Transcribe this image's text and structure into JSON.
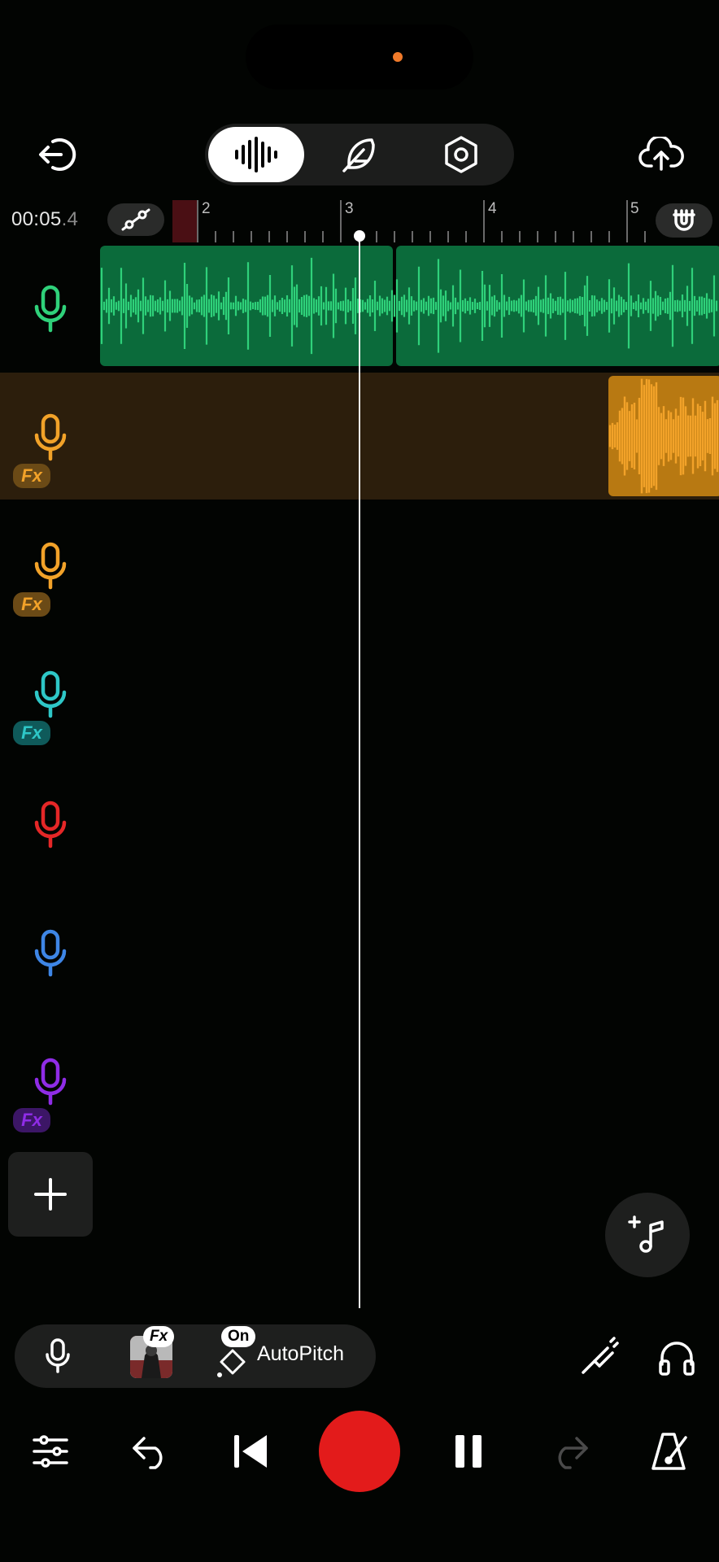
{
  "header": {
    "exit_icon": "exit-icon",
    "upload_icon": "cloud-upload-icon",
    "modes": [
      {
        "id": "waveform",
        "icon": "waveform-icon",
        "active": true
      },
      {
        "id": "feather",
        "icon": "feather-icon",
        "active": false
      },
      {
        "id": "settings",
        "icon": "hex-settings-icon",
        "active": false
      }
    ]
  },
  "timeline": {
    "timecode_main": "00:05",
    "timecode_fraction": ".4",
    "ruler_labels": [
      "2",
      "3",
      "4",
      "5"
    ],
    "automation_icon": "automation-icon",
    "snap_icon": "magnet-icon"
  },
  "tracks": [
    {
      "color": "#2fd17a",
      "fx": false
    },
    {
      "color": "#f2a229",
      "fx": true,
      "fx_label": "Fx",
      "fx_bg": "#6b4a16",
      "fx_fg": "#f2a229"
    },
    {
      "color": "#f2a229",
      "fx": true,
      "fx_label": "Fx",
      "fx_bg": "#6b4a16",
      "fx_fg": "#f2a229"
    },
    {
      "color": "#2ec7c7",
      "fx": true,
      "fx_label": "Fx",
      "fx_bg": "#0f5a5a",
      "fx_fg": "#2ec7c7"
    },
    {
      "color": "#e52727",
      "fx": false
    },
    {
      "color": "#3e86e6",
      "fx": false
    },
    {
      "color": "#8f2ce6",
      "fx": true,
      "fx_label": "Fx",
      "fx_bg": "#3c1666",
      "fx_fg": "#8f2ce6"
    }
  ],
  "tools": {
    "fx_label": "Fx",
    "on_label": "On",
    "autopitch_label": "AutoPitch"
  },
  "colors": {
    "accent_record": "#e31b1b",
    "track_green": "#0b6b3b",
    "wave_green": "#2fd17a",
    "track_orange_bg": "#2c1e0c",
    "wave_orange": "#f2a229"
  }
}
